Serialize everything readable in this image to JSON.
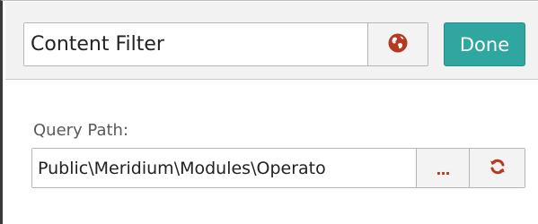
{
  "header": {
    "title_value": "Content Filter",
    "globe_icon": "globe-icon",
    "done_label": "Done"
  },
  "query": {
    "label": "Query Path:",
    "path_value": "Public\\Meridium\\Modules\\Operato",
    "browse_label": "...",
    "refresh_icon": "refresh-icon"
  },
  "colors": {
    "accent": "#2fa6a0",
    "icon": "#b53a22",
    "header_bg": "#f2f2f2"
  }
}
